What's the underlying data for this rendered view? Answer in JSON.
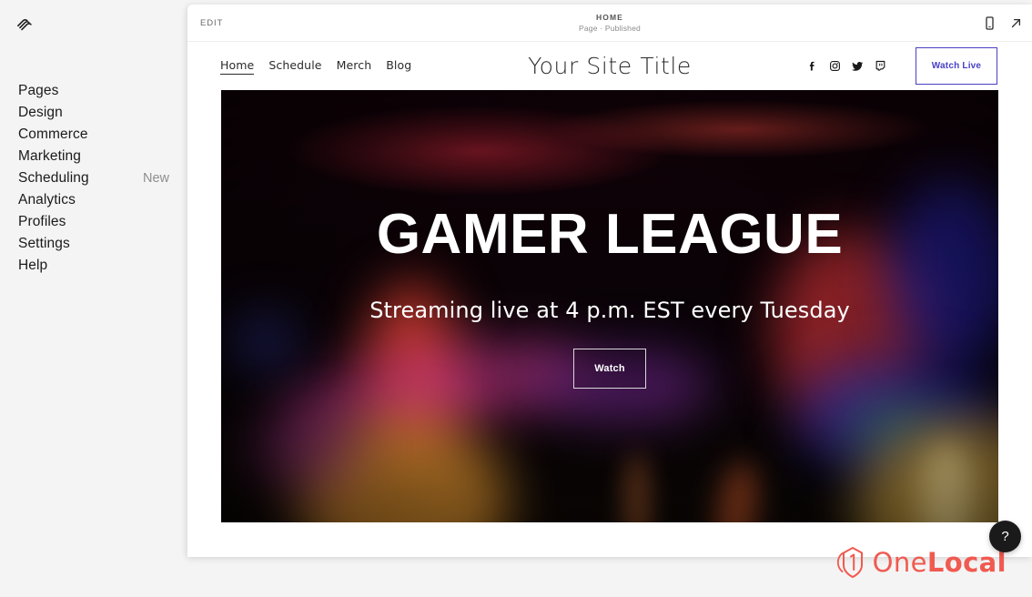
{
  "app": {
    "brand_icon": "squarespace-logo-icon",
    "background": "#f4f4f4"
  },
  "sidebar": {
    "items": [
      {
        "label": "Pages",
        "badge": ""
      },
      {
        "label": "Design",
        "badge": ""
      },
      {
        "label": "Commerce",
        "badge": ""
      },
      {
        "label": "Marketing",
        "badge": ""
      },
      {
        "label": "Scheduling",
        "badge": "New"
      },
      {
        "label": "Analytics",
        "badge": ""
      },
      {
        "label": "Profiles",
        "badge": ""
      },
      {
        "label": "Settings",
        "badge": ""
      },
      {
        "label": "Help",
        "badge": ""
      }
    ]
  },
  "editor_bar": {
    "edit_label": "EDIT",
    "page_title": "HOME",
    "page_subtitle": "Page · Published",
    "icons": [
      {
        "name": "mobile-view-icon"
      },
      {
        "name": "open-external-icon"
      }
    ]
  },
  "site": {
    "title": "Your Site Title",
    "nav": [
      {
        "label": "Home",
        "active": true
      },
      {
        "label": "Schedule",
        "active": false
      },
      {
        "label": "Merch",
        "active": false
      },
      {
        "label": "Blog",
        "active": false
      }
    ],
    "socials": [
      {
        "name": "facebook-icon"
      },
      {
        "name": "instagram-icon"
      },
      {
        "name": "twitter-icon"
      },
      {
        "name": "twitch-icon"
      }
    ],
    "cta": {
      "label": "Watch Live",
      "color": "#4840c6"
    }
  },
  "hero": {
    "title": "GAMER LEAGUE",
    "subtitle": "Streaming live at 4 p.m. EST every Tuesday",
    "button_label": "Watch",
    "background_description": "dark bokeh lights photo, magenta and red top, amber and blue bottom"
  },
  "help": {
    "label": "?"
  },
  "watermark": {
    "mark": "onelocal-logo-icon",
    "word_light": "One",
    "word_bold": "Local",
    "color": "#f05a50"
  }
}
